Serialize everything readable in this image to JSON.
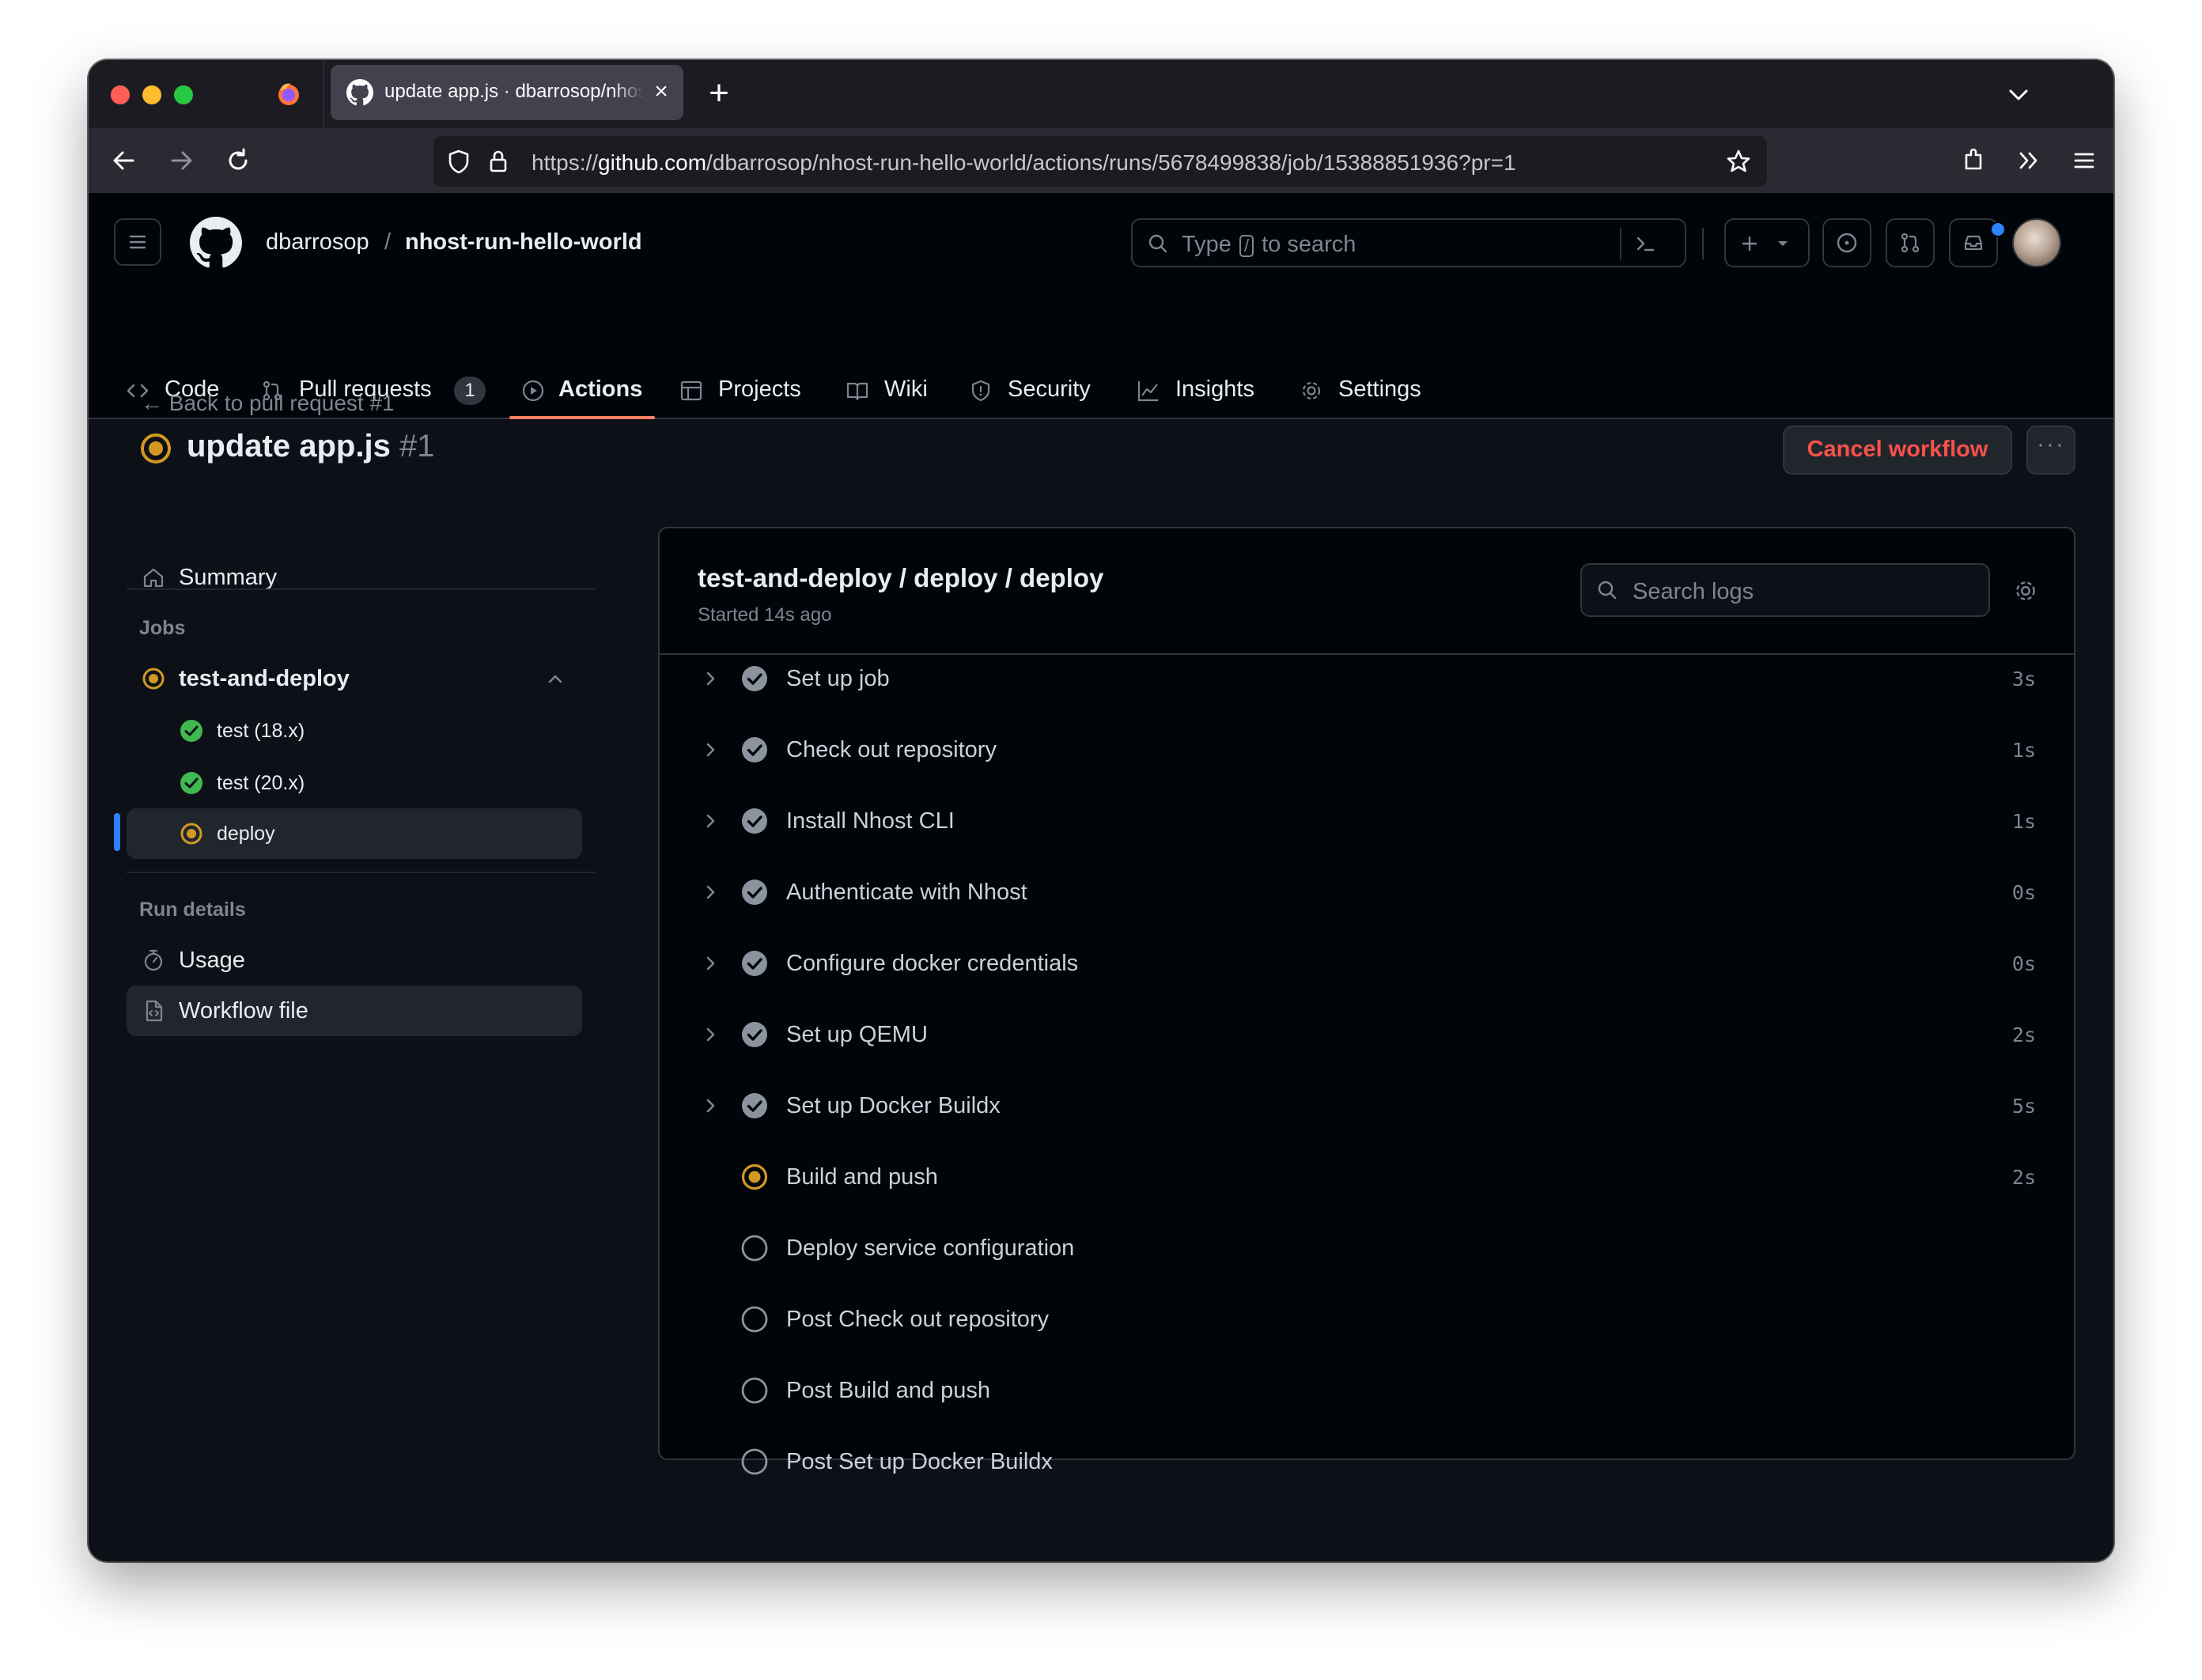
{
  "browser": {
    "tab_title": "update app.js · dbarrosop/nhost-run-hello-world",
    "url_prefix": "https://",
    "url_host": "github.com",
    "url_path": "/dbarrosop/nhost-run-hello-world/actions/runs/5678499838/job/15388851936?pr=1"
  },
  "header": {
    "owner": "dbarrosop",
    "separator": "/",
    "repo": "nhost-run-hello-world",
    "search_before": "Type",
    "search_key": "/",
    "search_after": "to search"
  },
  "repo_nav": {
    "code": "Code",
    "pulls": "Pull requests",
    "pulls_count": "1",
    "actions": "Actions",
    "projects": "Projects",
    "wiki": "Wiki",
    "security": "Security",
    "insights": "Insights",
    "settings": "Settings"
  },
  "run": {
    "back_link": "Back to pull request #1",
    "title": "update app.js",
    "number": "#1",
    "cancel_label": "Cancel workflow",
    "more_label": "···"
  },
  "sidebar": {
    "summary": "Summary",
    "jobs_heading": "Jobs",
    "workflow_group": "test-and-deploy",
    "jobs": [
      {
        "label": "test (18.x)",
        "status": "success"
      },
      {
        "label": "test (20.x)",
        "status": "success"
      },
      {
        "label": "deploy",
        "status": "in_progress"
      }
    ],
    "run_details_heading": "Run details",
    "usage": "Usage",
    "workflow_file": "Workflow file"
  },
  "job": {
    "title": "test-and-deploy / deploy / deploy",
    "started": "Started 14s ago",
    "search_placeholder": "Search logs",
    "steps": [
      {
        "name": "Set up job",
        "status": "success",
        "duration": "3s"
      },
      {
        "name": "Check out repository",
        "status": "success",
        "duration": "1s"
      },
      {
        "name": "Install Nhost CLI",
        "status": "success",
        "duration": "1s"
      },
      {
        "name": "Authenticate with Nhost",
        "status": "success",
        "duration": "0s"
      },
      {
        "name": "Configure docker credentials",
        "status": "success",
        "duration": "0s"
      },
      {
        "name": "Set up QEMU",
        "status": "success",
        "duration": "2s"
      },
      {
        "name": "Set up Docker Buildx",
        "status": "success",
        "duration": "5s"
      },
      {
        "name": "Build and push",
        "status": "in_progress",
        "duration": "2s"
      },
      {
        "name": "Deploy service configuration",
        "status": "pending",
        "duration": ""
      },
      {
        "name": "Post Check out repository",
        "status": "pending",
        "duration": ""
      },
      {
        "name": "Post Build and push",
        "status": "pending",
        "duration": ""
      },
      {
        "name": "Post Set up Docker Buildx",
        "status": "pending",
        "duration": ""
      }
    ]
  },
  "colors": {
    "in_progress": "#d29922",
    "success": "#3fb950",
    "danger": "#f85149",
    "accent_underline": "#f78166",
    "active_indicator": "#2f81f7"
  }
}
